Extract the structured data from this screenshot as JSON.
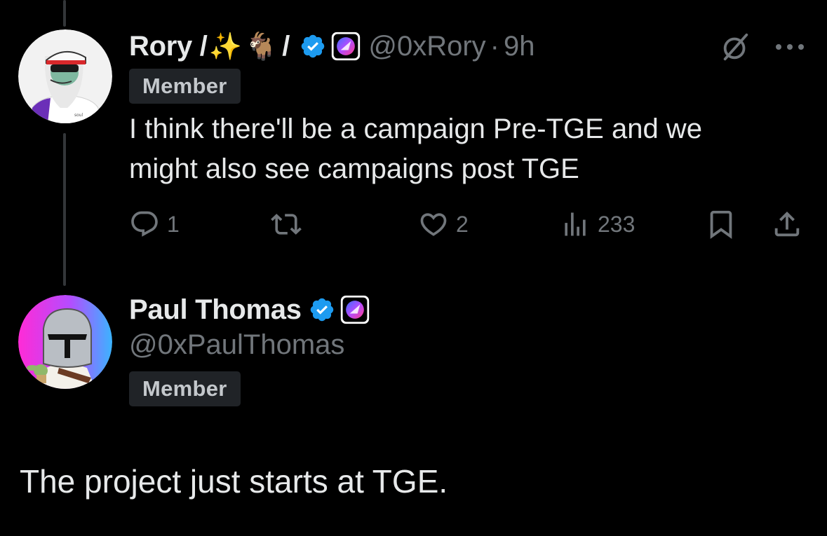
{
  "reply_tweet": {
    "display_name": "Rory /",
    "emoji_1": "✨",
    "emoji_2": "🐐",
    "separator": "/",
    "handle": "@0xRory",
    "dot": "·",
    "time": "9h",
    "role_badge": "Member",
    "text_line1": "I think there'll be a campaign Pre-TGE and we",
    "text_line2": "might also see campaigns post TGE",
    "metrics": {
      "replies": "1",
      "likes": "2",
      "views": "233"
    },
    "icons": {
      "verified": "verified-badge-icon",
      "affiliate": "affiliate-badge-icon",
      "grok": "grok-icon",
      "more": "more-options-icon",
      "reply": "reply-icon",
      "retweet": "retweet-icon",
      "like": "heart-icon",
      "views": "views-icon",
      "bookmark": "bookmark-icon",
      "share": "share-icon"
    }
  },
  "main_tweet": {
    "display_name": "Paul Thomas",
    "handle": "@0xPaulThomas",
    "role_badge": "Member",
    "text": "The project just starts at TGE."
  },
  "colors": {
    "background": "#000000",
    "text_primary": "#e7e9ea",
    "text_secondary": "#71767b",
    "verified_blue": "#1d9bf0",
    "chip_bg": "#202327"
  }
}
